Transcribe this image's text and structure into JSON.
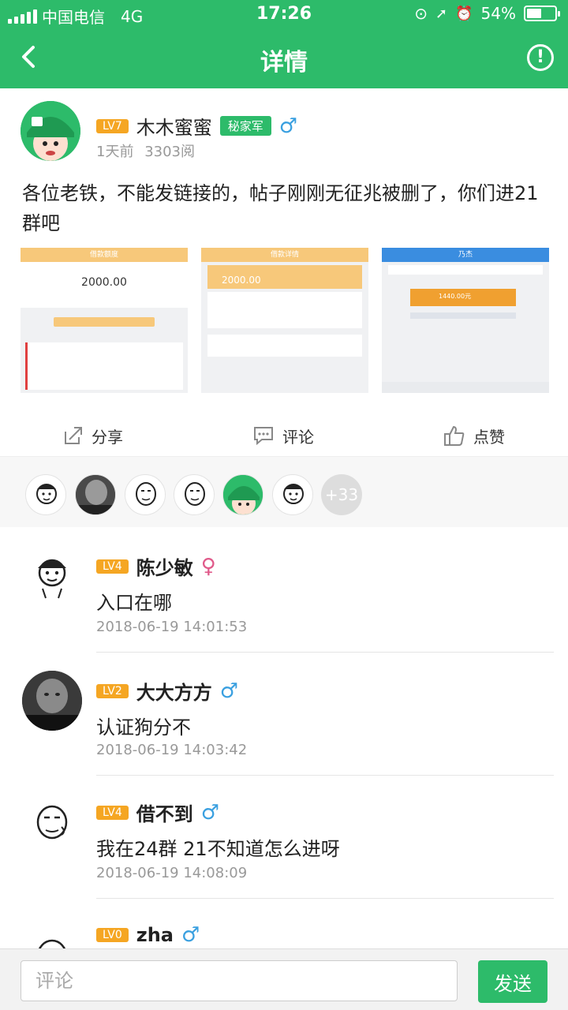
{
  "status_bar": {
    "carrier": "中国电信",
    "network": "4G",
    "time": "17:26",
    "battery_text": "54%",
    "battery_level": 0.54
  },
  "nav": {
    "title": "详情",
    "back_icon": "chevron-left-icon",
    "info_icon": "info-circle-icon"
  },
  "post": {
    "author": {
      "level": "LV7",
      "name": "木木蜜蜜",
      "badge": "秘家军",
      "gender": "♂"
    },
    "time": "1天前",
    "views": "3303阅",
    "content": "各位老铁，不能发链接的，帖子刚刚无征兆被删了，你们进21群吧",
    "images": [
      {
        "header": "借款额度",
        "amount": "2000.00"
      },
      {
        "header": "借款详情",
        "amount": "2000.00"
      },
      {
        "header": "乃杰",
        "amount": "1440.00元"
      }
    ]
  },
  "actions": {
    "share": "分享",
    "comment": "评论",
    "like": "点赞"
  },
  "likers_more": "+33",
  "comments": [
    {
      "level": "LV4",
      "name": "陈少敏",
      "gender": "♀",
      "text": "入口在哪",
      "time": "2018-06-19 14:01:53"
    },
    {
      "level": "LV2",
      "name": "大大方方",
      "gender": "♂",
      "text": "认证狗分不",
      "time": "2018-06-19 14:03:42"
    },
    {
      "level": "LV4",
      "name": "借不到",
      "gender": "♂",
      "text": "我在24群 21不知道怎么进呀",
      "time": "2018-06-19 14:08:09"
    },
    {
      "level": "LV0",
      "name": "zha",
      "gender": "♂",
      "text": "",
      "time": ""
    }
  ],
  "input": {
    "placeholder": "评论",
    "send_label": "发送"
  },
  "colors": {
    "brand": "#2dbb6a",
    "level": "#f5a623",
    "male": "#3aa0e0",
    "female": "#e05a8a"
  }
}
